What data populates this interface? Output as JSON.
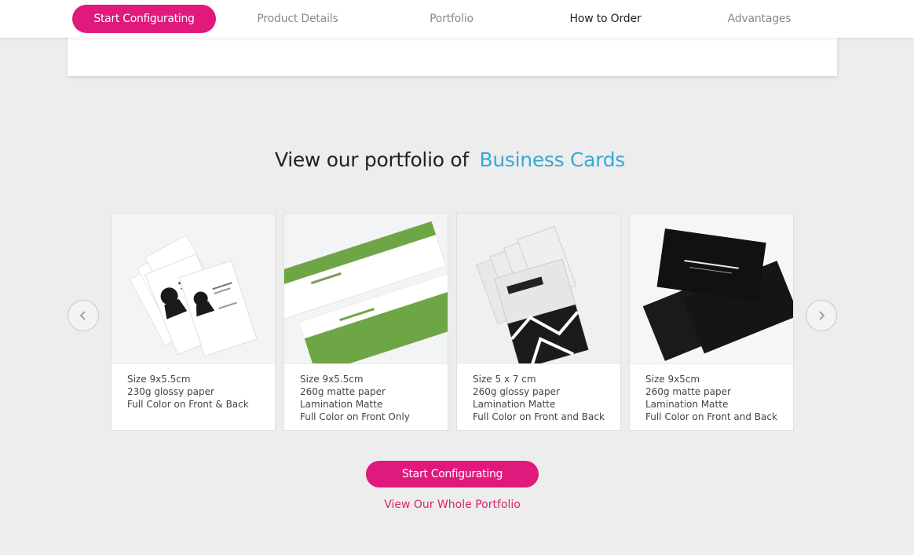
{
  "nav": {
    "cta_label": "Start Configurating",
    "links": [
      {
        "label": "Product Details"
      },
      {
        "label": "Portfolio"
      },
      {
        "label": "How to Order"
      },
      {
        "label": "Advantages"
      }
    ],
    "active": "How to Order"
  },
  "portfolio": {
    "heading_prefix": "View our portfolio of",
    "heading_accent": "Business Cards",
    "cards": [
      {
        "image": "business-cards-cat-logo-photo",
        "specs": [
          "Size 9x5.5cm",
          "230g glossy paper",
          "Full Color on Front & Back"
        ]
      },
      {
        "image": "business-cards-green-stripe-photo",
        "specs": [
          "Size 9x5.5cm",
          "260g matte paper",
          "Lamination Matte",
          "Full Color on Front Only"
        ]
      },
      {
        "image": "business-cards-pras-jewelry-photo",
        "specs": [
          "Size 5 x 7 cm",
          "260g glossy paper",
          "Lamination Matte",
          "Full Color on Front and Back"
        ]
      },
      {
        "image": "business-cards-zalora-photo",
        "specs": [
          "Size 9x5cm",
          "260g matte paper",
          "Lamination Matte",
          "Full Color on Front and Back"
        ]
      }
    ],
    "cta_label": "Start Configurating",
    "view_all_label": "View Our Whole Portfolio"
  },
  "icons": {
    "prev": "chevron-left-icon",
    "next": "chevron-right-icon"
  },
  "colors": {
    "accent_pink": "#e0197d",
    "accent_blue": "#3aa8d6",
    "background": "#ededed"
  }
}
